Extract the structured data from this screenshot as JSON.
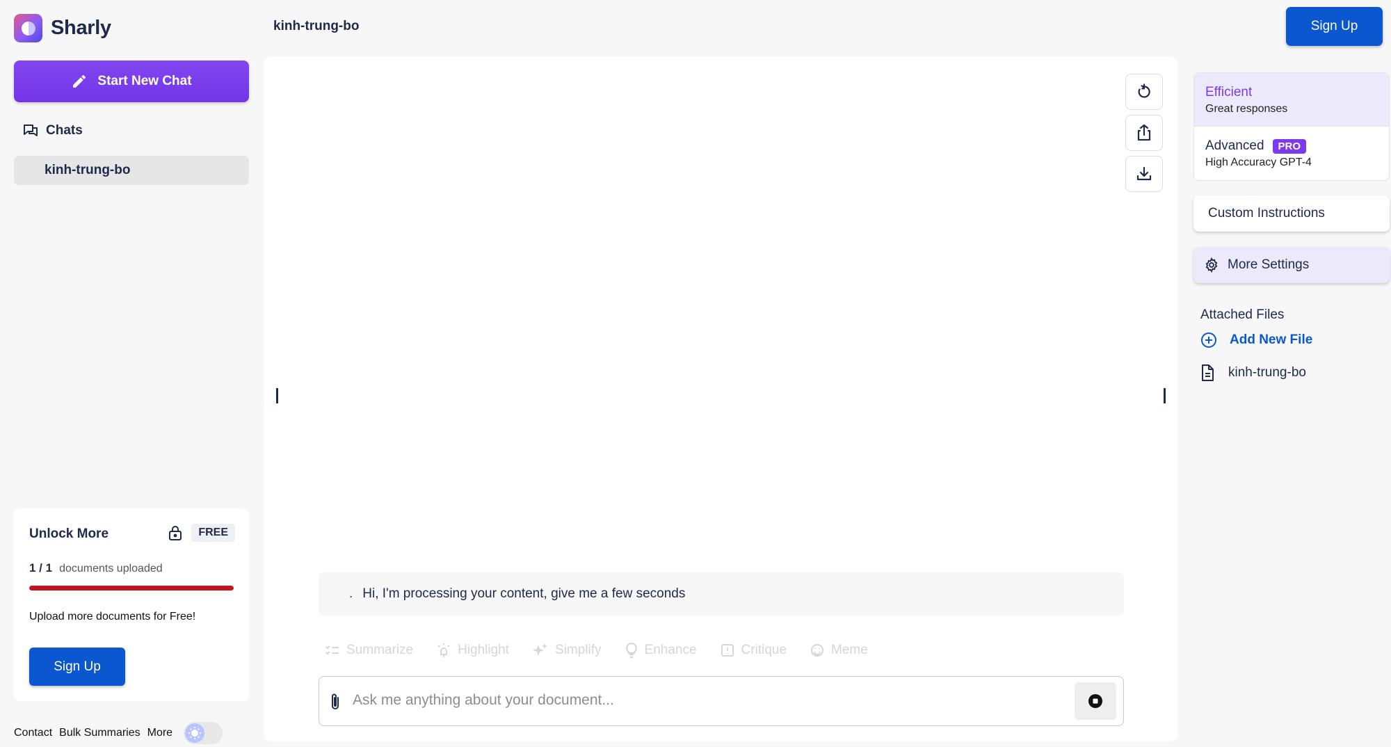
{
  "brand": {
    "name": "Sharly"
  },
  "sidebar": {
    "new_chat_label": "Start New Chat",
    "chats_label": "Chats",
    "chat_items": [
      {
        "label": "kinh-trung-bo"
      }
    ]
  },
  "unlock": {
    "title": "Unlock More",
    "plan_badge": "FREE",
    "count": "1 / 1",
    "count_label": "documents uploaded",
    "progress": 1.0,
    "message": "Upload more documents for Free!",
    "signup_label": "Sign Up"
  },
  "footer": {
    "links": [
      "Contact",
      "Bulk Summaries",
      "More"
    ]
  },
  "header": {
    "document_title": "kinh-trung-bo",
    "signup_label": "Sign Up"
  },
  "main": {
    "message_prefix": ".",
    "message": "Hi, I'm processing your content, give me a few seconds",
    "actions": [
      "Summarize",
      "Highlight",
      "Simplify",
      "Enhance",
      "Critique",
      "Meme"
    ],
    "input_placeholder": "Ask me anything about your document..."
  },
  "right": {
    "models": [
      {
        "name": "Efficient",
        "sub": "Great responses",
        "active": true
      },
      {
        "name": "Advanced",
        "badge": "PRO",
        "sub": "High Accuracy GPT-4",
        "active": false
      }
    ],
    "custom_instructions_label": "Custom Instructions",
    "more_settings_label": "More Settings",
    "attached_files_title": "Attached Files",
    "add_file_label": "Add New File",
    "files": [
      {
        "name": "kinh-trung-bo"
      }
    ]
  },
  "colors": {
    "accent_purple": "#7c3aed",
    "primary_blue": "#0b57d0",
    "progress_red": "#c0151f"
  }
}
